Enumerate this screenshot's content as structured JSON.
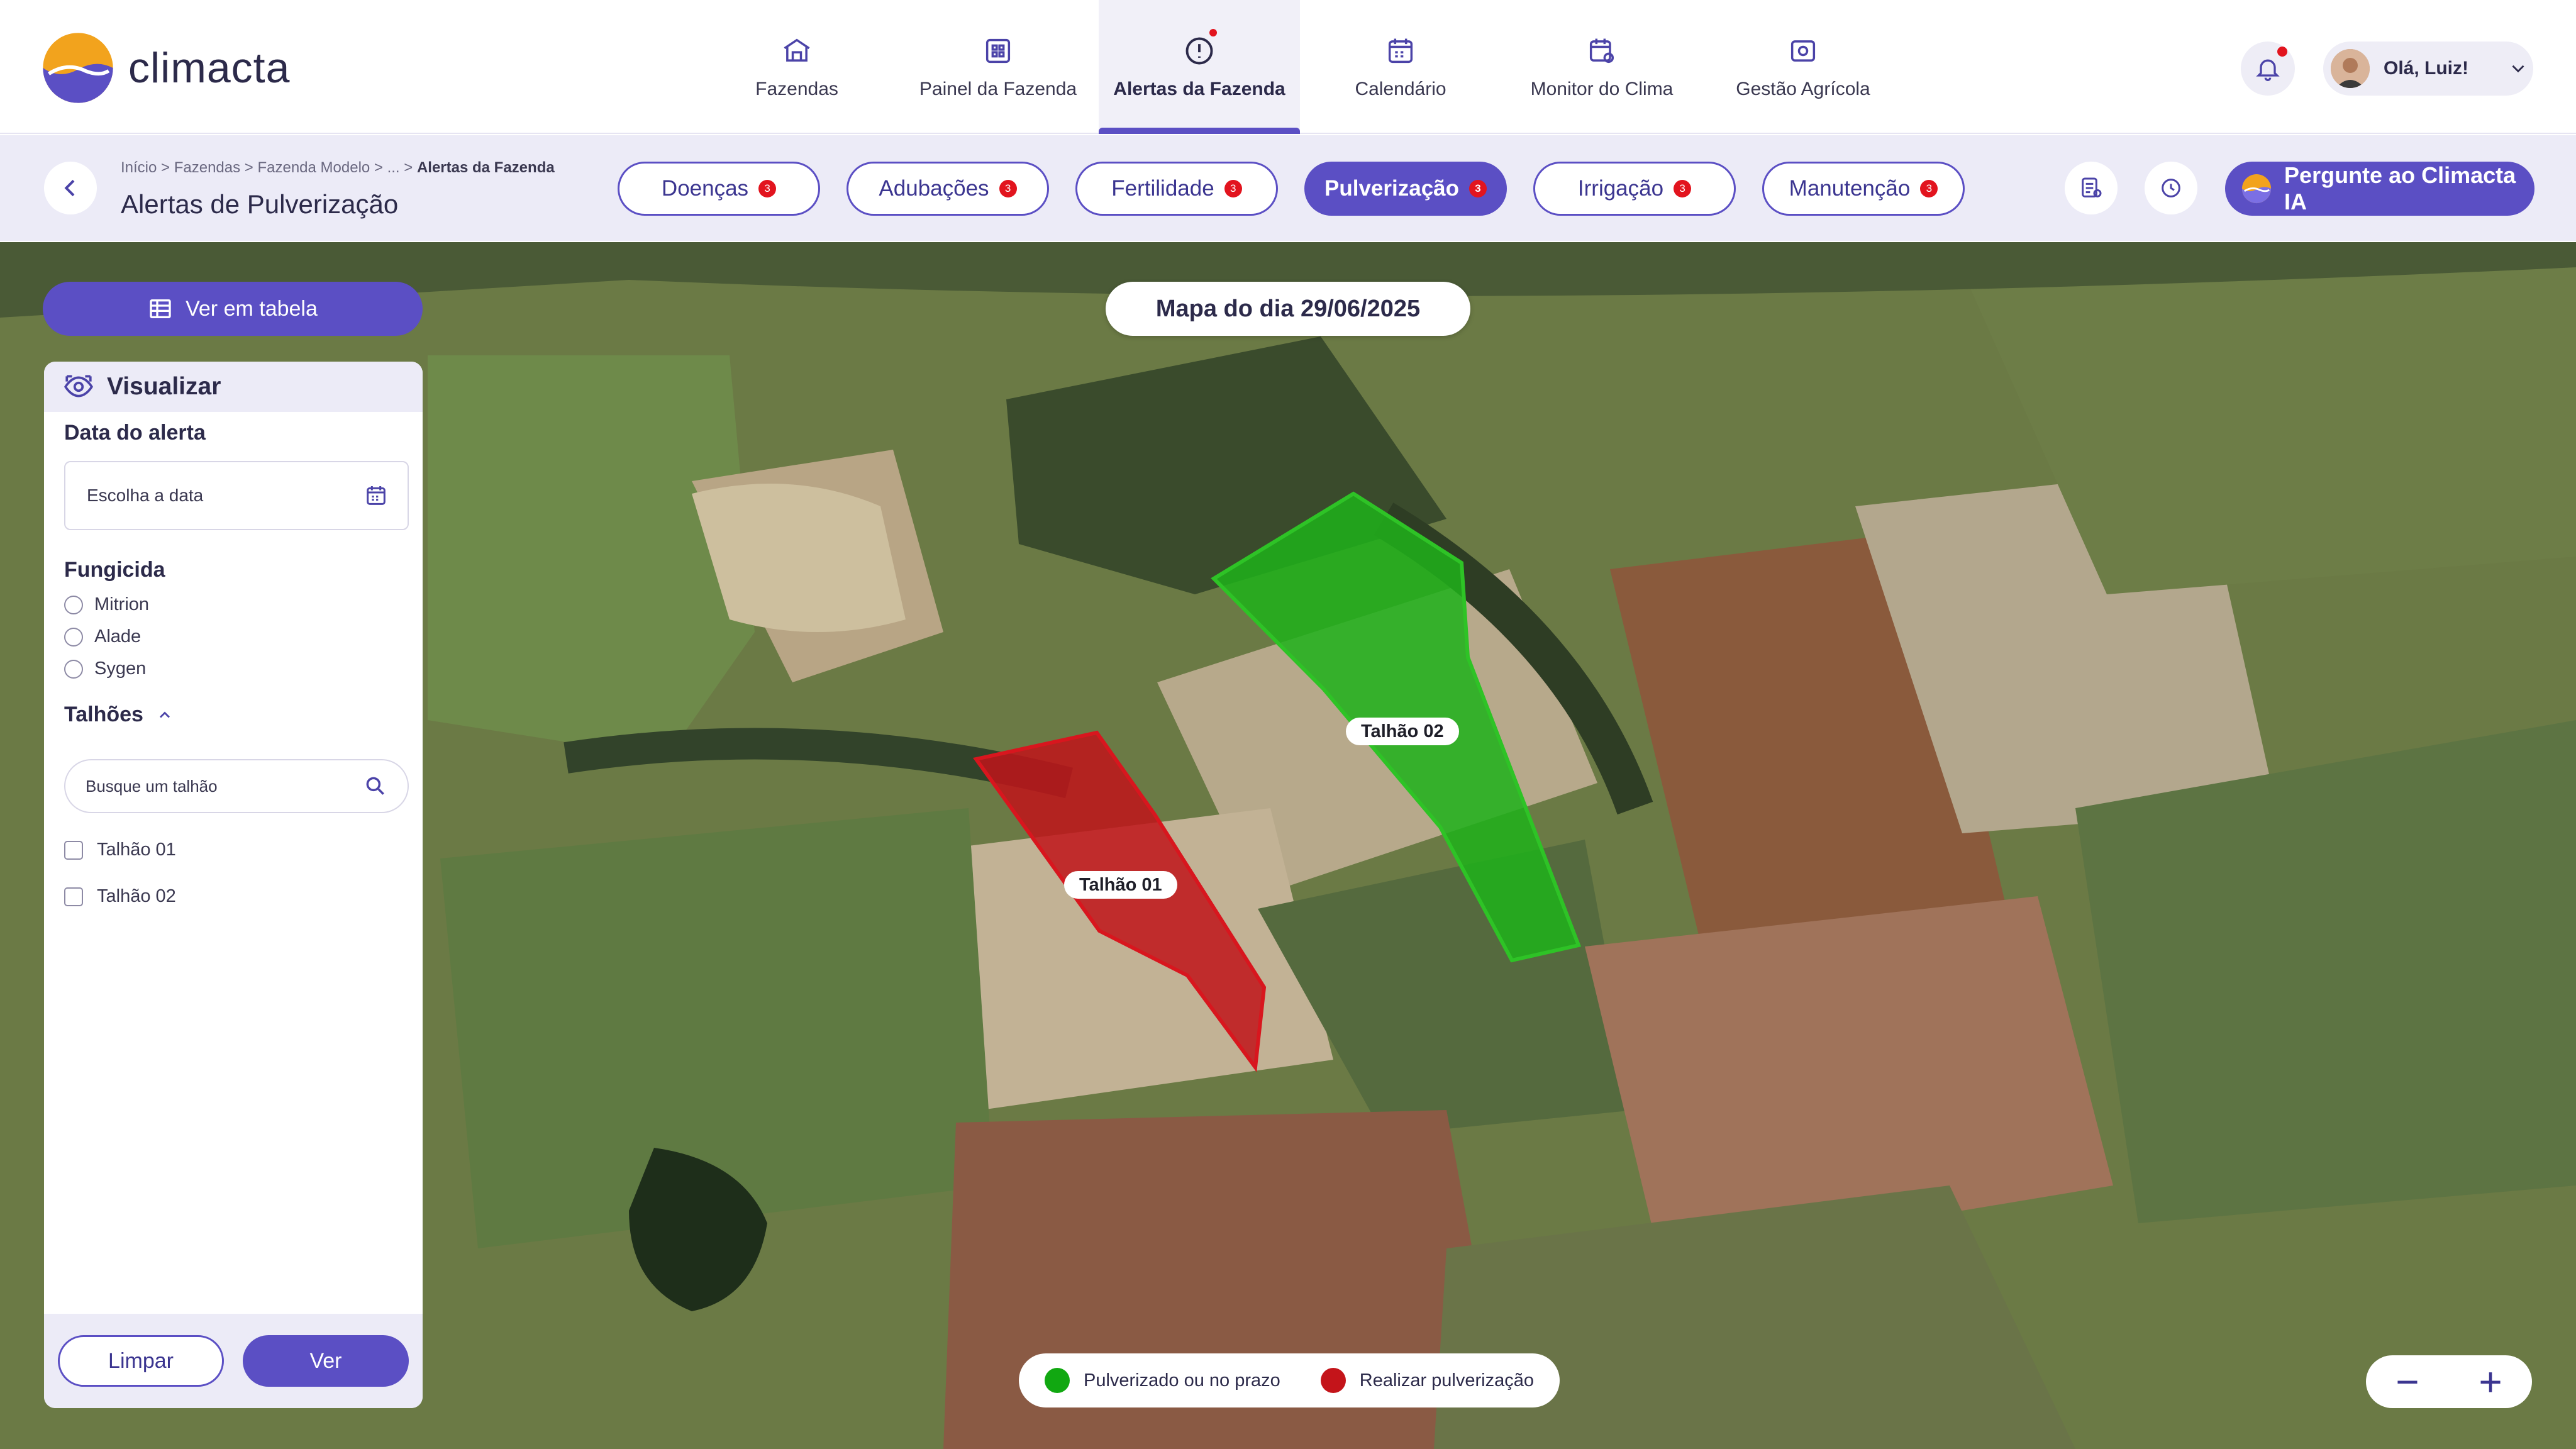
{
  "app": {
    "name": "climacta"
  },
  "nav": {
    "items": [
      {
        "label": "Fazendas",
        "icon": "farm-icon"
      },
      {
        "label": "Painel da Fazenda",
        "icon": "dashboard-icon"
      },
      {
        "label": "Alertas da Fazenda",
        "icon": "alert-icon",
        "active": true
      },
      {
        "label": "Calendário",
        "icon": "calendar-icon"
      },
      {
        "label": "Monitor do Clima",
        "icon": "weather-icon"
      },
      {
        "label": "Gestão Agrícola",
        "icon": "management-icon"
      }
    ]
  },
  "user": {
    "greeting": "Olá, Luiz!"
  },
  "breadcrumb": {
    "path": "Início > Fazendas > Fazenda Modelo > ... > ",
    "current": "Alertas da Fazenda"
  },
  "page": {
    "title": "Alertas de Pulverização"
  },
  "tabs": [
    {
      "label": "Doenças",
      "count": "3"
    },
    {
      "label": "Adubações",
      "count": "3"
    },
    {
      "label": "Fertilidade",
      "count": "3"
    },
    {
      "label": "Pulverização",
      "count": "3",
      "active": true
    },
    {
      "label": "Irrigação",
      "count": "3"
    },
    {
      "label": "Manutenção",
      "count": "3"
    }
  ],
  "ai_button": {
    "label": "Pergunte ao Climacta IA"
  },
  "map": {
    "table_button": "Ver em tabela",
    "date_label": "Mapa do dia 29/06/2025",
    "fields": [
      {
        "label": "Talhão 01",
        "status_color": "#c0141a"
      },
      {
        "label": "Talhão 02",
        "status_color": "#1fb21a"
      }
    ],
    "legend": [
      {
        "label": "Pulverizado ou no prazo",
        "color": "#11a811"
      },
      {
        "label": "Realizar pulverização",
        "color": "#c4141a"
      }
    ],
    "zoom_out": "−",
    "zoom_in": "+"
  },
  "panel": {
    "title": "Visualizar",
    "date_section": "Data do alerta",
    "date_placeholder": "Escolha a data",
    "fungicide_section": "Fungicida",
    "fungicides": [
      "Mitrion",
      "Alade",
      "Sygen"
    ],
    "fields_section": "Talhões",
    "search_placeholder": "Busque um talhão",
    "field_options": [
      "Talhão 01",
      "Talhão 02"
    ],
    "clear_button": "Limpar",
    "see_button": "Ver"
  },
  "colors": {
    "accent": "#5b4fc4",
    "alert": "#e2141e"
  }
}
